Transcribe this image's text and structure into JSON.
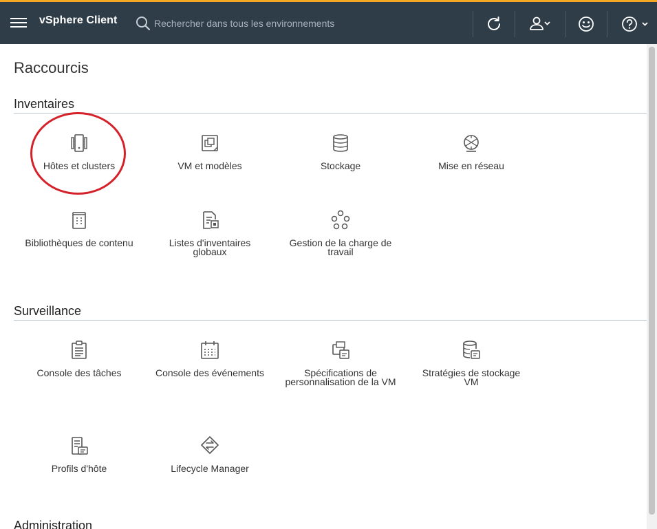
{
  "header": {
    "app_title": "vSphere Client",
    "search_placeholder": "Rechercher dans tous les environnements",
    "accent_color": "#f5a623",
    "bar_color": "#2e3d48"
  },
  "page": {
    "title": "Raccourcis"
  },
  "sections": {
    "inventaires": {
      "title": "Inventaires",
      "tiles": [
        {
          "label": "Hôtes et clusters",
          "icon": "hosts-clusters-icon"
        },
        {
          "label": "VM et modèles",
          "icon": "vm-templates-icon"
        },
        {
          "label": "Stockage",
          "icon": "storage-icon"
        },
        {
          "label": "Mise en réseau",
          "icon": "networking-icon"
        },
        {
          "label": "Bibliothèques de contenu",
          "icon": "content-library-icon"
        },
        {
          "label": "Listes d'inventaires globaux",
          "icon": "global-inventory-icon"
        },
        {
          "label": "Gestion de la charge de travail",
          "icon": "workload-management-icon"
        }
      ]
    },
    "surveillance": {
      "title": "Surveillance",
      "tiles": [
        {
          "label": "Console des tâches",
          "icon": "task-console-icon"
        },
        {
          "label": "Console des événements",
          "icon": "event-console-icon"
        },
        {
          "label": "Spécifications de personnalisation de la VM",
          "icon": "vm-customization-icon"
        },
        {
          "label": "Stratégies de stockage VM",
          "icon": "storage-policies-icon"
        },
        {
          "label": "Profils d'hôte",
          "icon": "host-profiles-icon"
        },
        {
          "label": "Lifecycle Manager",
          "icon": "lifecycle-manager-icon"
        }
      ]
    },
    "administration": {
      "title": "Administration"
    }
  },
  "annotation": {
    "highlight_color": "#d4222a"
  }
}
